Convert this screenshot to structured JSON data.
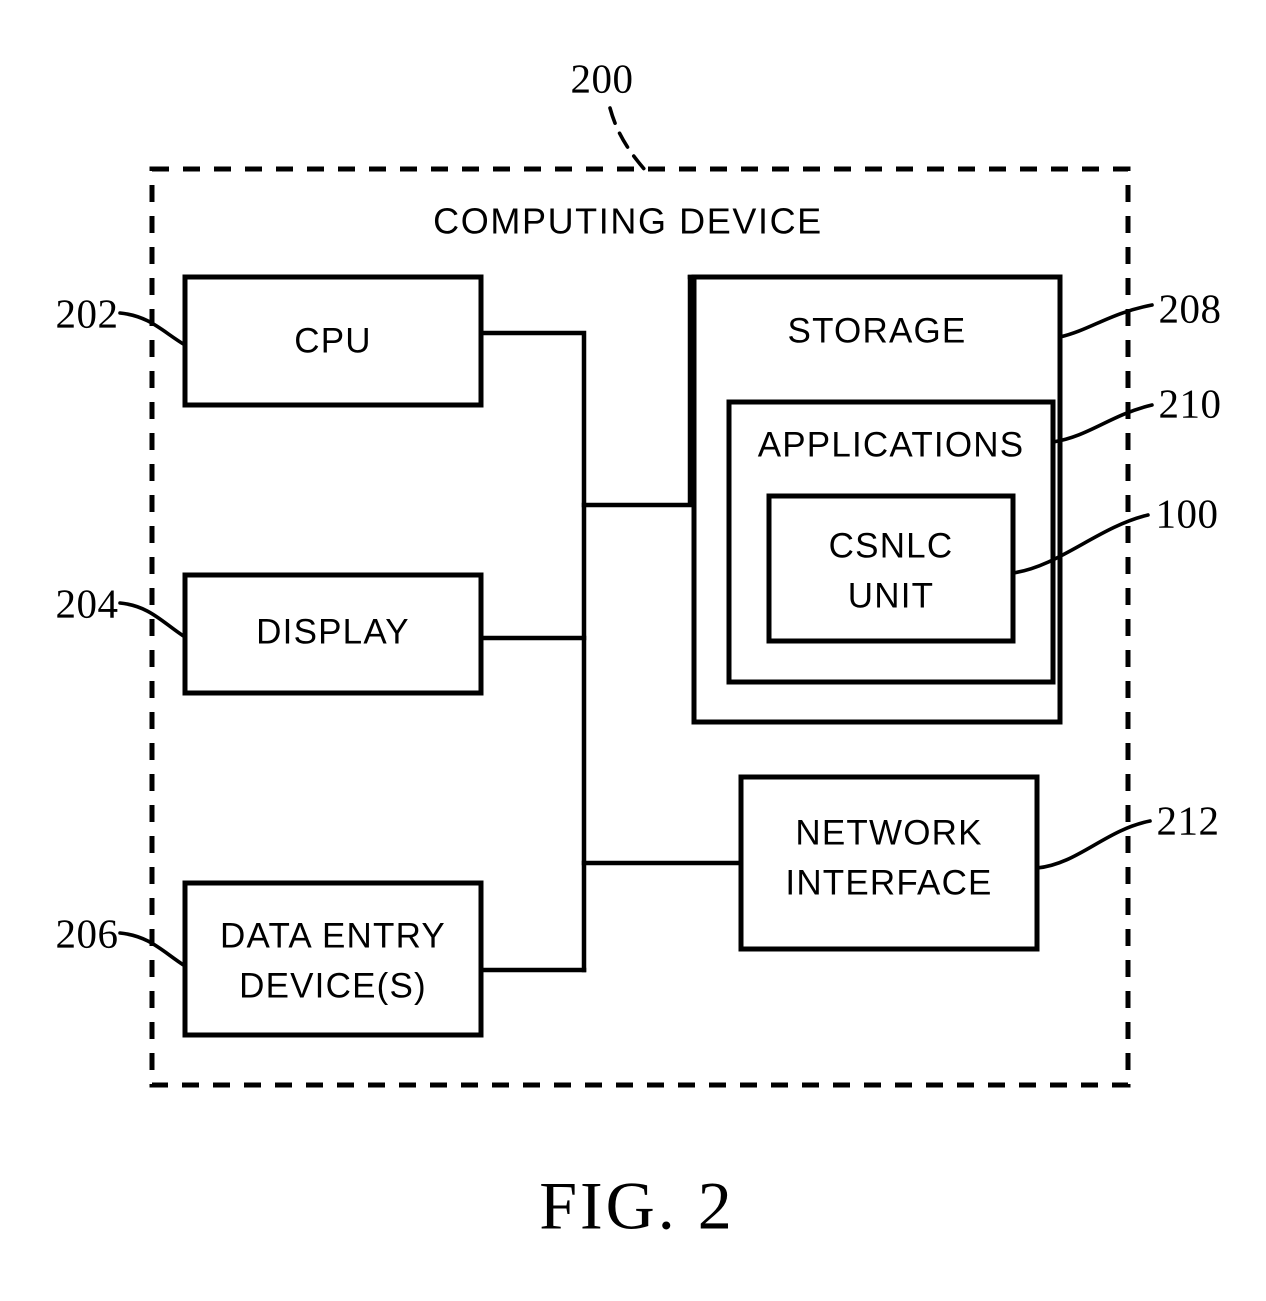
{
  "figure": {
    "caption": "FIG. 2",
    "title": "COMPUTING DEVICE",
    "title_ref": "200"
  },
  "colors": {
    "stroke": "#000000",
    "background": "#ffffff"
  },
  "blocks": [
    {
      "id": "cpu",
      "label": "CPU",
      "ref": "202",
      "ref_side": "left"
    },
    {
      "id": "display",
      "label": "DISPLAY",
      "ref": "204",
      "ref_side": "left"
    },
    {
      "id": "data-entry",
      "label_line1": "DATA ENTRY",
      "label_line2": "DEVICE(S)",
      "ref": "206",
      "ref_side": "left"
    },
    {
      "id": "storage",
      "label": "STORAGE",
      "ref": "208",
      "ref_side": "right"
    },
    {
      "id": "applications",
      "label": "APPLICATIONS",
      "ref": "210",
      "ref_side": "right"
    },
    {
      "id": "csnlc-unit",
      "label_line1": "CSNLC",
      "label_line2": "UNIT",
      "ref": "100",
      "ref_side": "right"
    },
    {
      "id": "network-interface",
      "label_line1": "NETWORK",
      "label_line2": "INTERFACE",
      "ref": "212",
      "ref_side": "right"
    }
  ],
  "labels": {
    "cpu": "CPU",
    "display": "DISPLAY",
    "data_entry_line1": "DATA ENTRY",
    "data_entry_line2": "DEVICE(S)",
    "storage": "STORAGE",
    "applications": "APPLICATIONS",
    "csnlc_line1": "CSNLC",
    "csnlc_line2": "UNIT",
    "network_line1": "NETWORK",
    "network_line2": "INTERFACE"
  },
  "refs": {
    "device": "200",
    "cpu": "202",
    "display": "204",
    "data_entry": "206",
    "storage": "208",
    "applications": "210",
    "csnlc": "100",
    "network_interface": "212"
  }
}
